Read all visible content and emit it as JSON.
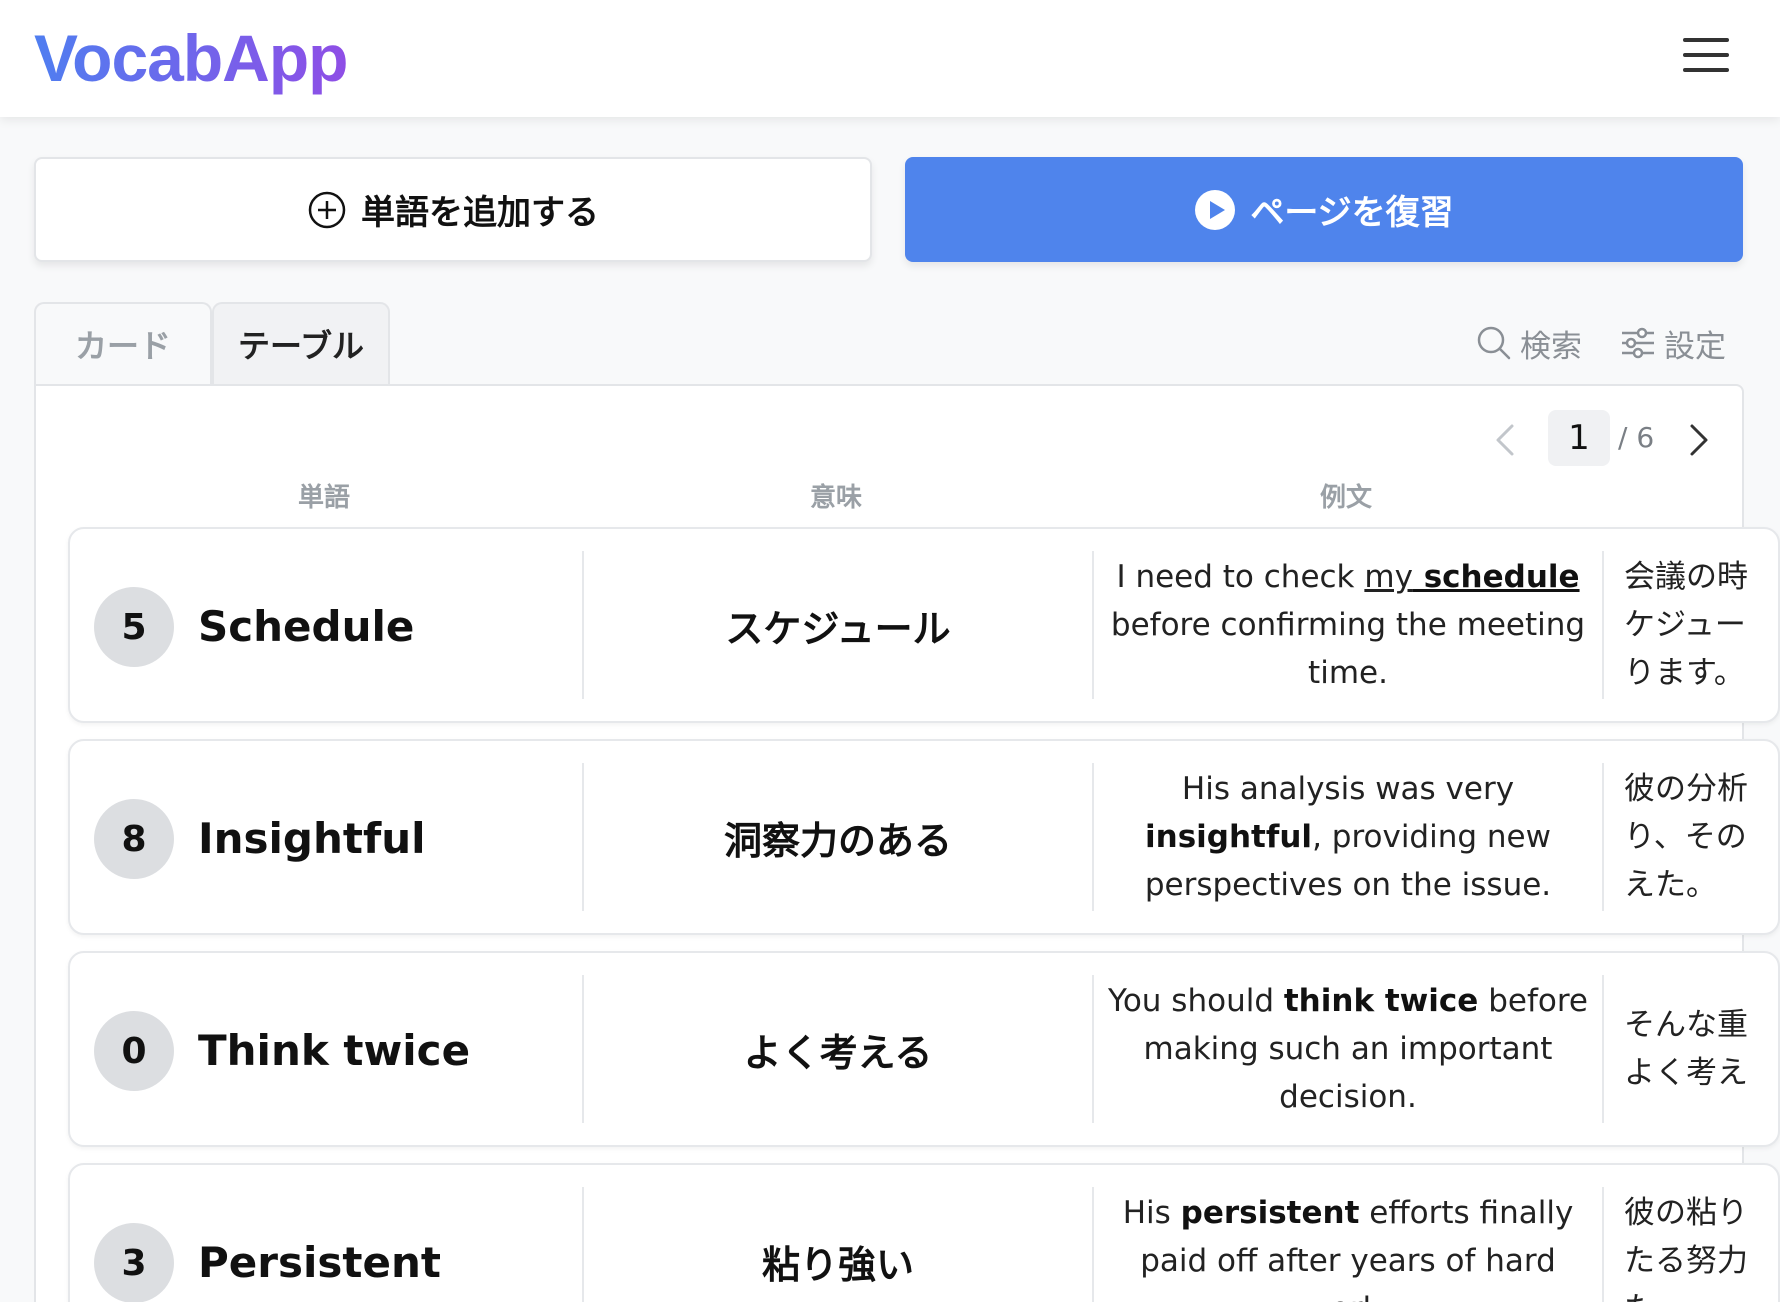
{
  "app": {
    "title": "VocabApp"
  },
  "actions": {
    "add_label": "単語を追加する",
    "review_label": "ページを復習"
  },
  "tabs": [
    {
      "label": "カード",
      "active": false
    },
    {
      "label": "テーブル",
      "active": true
    }
  ],
  "toolbar": {
    "search_label": "検索",
    "settings_label": "設定"
  },
  "pagination": {
    "current": "1",
    "total": "/ 6"
  },
  "columns": {
    "word": "単語",
    "meaning": "意味",
    "example": "例文"
  },
  "rows": [
    {
      "count": "5",
      "word": "Schedule",
      "meaning": "スケジュール",
      "example": {
        "parts": [
          {
            "t": "I need to check ",
            "s": ""
          },
          {
            "t": "my",
            "s": "ul"
          },
          {
            "t": " schedule",
            "s": "bul"
          },
          {
            "t": " before confirming the meeting time.",
            "s": ""
          }
        ]
      },
      "translation_lines": [
        "会議の時",
        "ケジュー",
        "ります。"
      ]
    },
    {
      "count": "8",
      "word": "Insightful",
      "meaning": "洞察力のある",
      "example": {
        "parts": [
          {
            "t": "His analysis was very ",
            "s": ""
          },
          {
            "t": "insightful",
            "s": "b"
          },
          {
            "t": ", providing new perspectives on the issue.",
            "s": ""
          }
        ]
      },
      "translation_lines": [
        "彼の分析",
        "り、その",
        "えた。"
      ]
    },
    {
      "count": "0",
      "word": "Think twice",
      "meaning": "よく考える",
      "example": {
        "parts": [
          {
            "t": "You should ",
            "s": ""
          },
          {
            "t": "think twice",
            "s": "b"
          },
          {
            "t": " before making such an important decision.",
            "s": ""
          }
        ]
      },
      "translation_lines": [
        "そんな重",
        "よく考え"
      ]
    },
    {
      "count": "3",
      "word": "Persistent",
      "meaning": "粘り強い",
      "example": {
        "parts": [
          {
            "t": "His ",
            "s": ""
          },
          {
            "t": "persistent",
            "s": "b"
          },
          {
            "t": " efforts finally paid off after years of hard work.",
            "s": ""
          }
        ]
      },
      "translation_lines": [
        "彼の粘り",
        "たる努力",
        "た。"
      ]
    }
  ],
  "colors": {
    "primary": "#4f84ec",
    "logo_gradient_start": "#4f7ef0",
    "logo_gradient_end": "#8f4ee6",
    "badge_bg": "#dcdee1"
  },
  "icons": {
    "menu": "hamburger-menu-icon",
    "add": "plus-circle-icon",
    "review": "play-circle-icon",
    "search": "search-icon",
    "settings": "sliders-icon",
    "prev": "chevron-left-icon",
    "next": "chevron-right-icon"
  }
}
